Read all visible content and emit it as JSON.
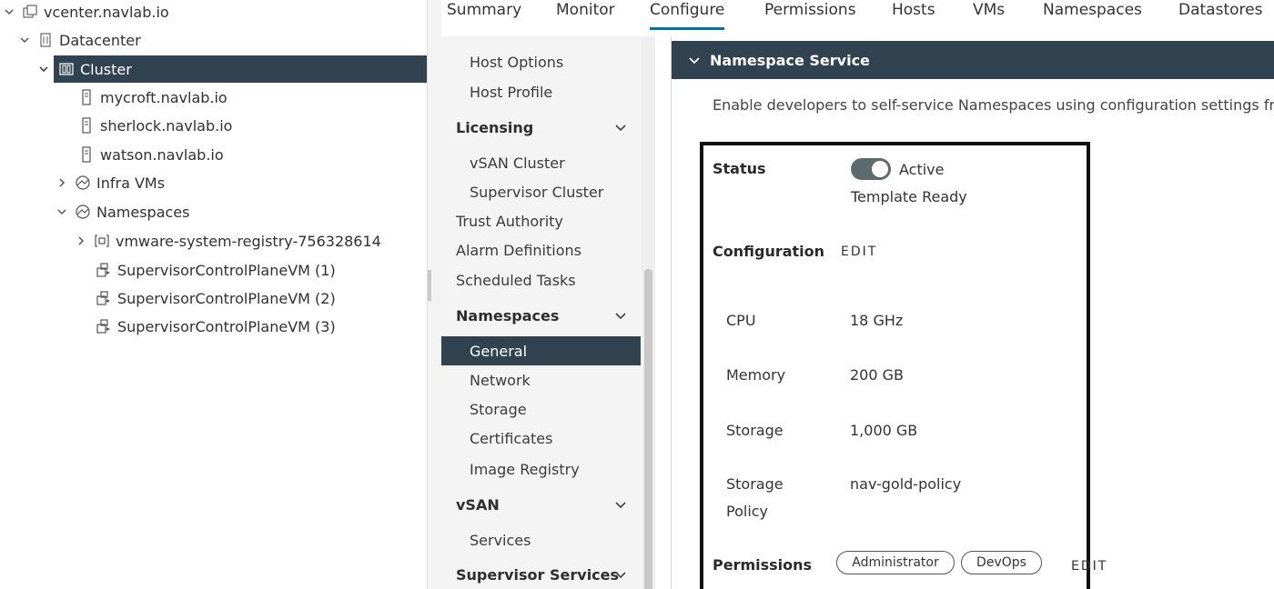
{
  "tree": {
    "items": [
      {
        "label": "vcenter.navlab.io",
        "icon": "vcenter-icon",
        "chev": "down"
      },
      {
        "label": "Datacenter",
        "icon": "datacenter-icon",
        "chev": "down"
      },
      {
        "label": "Cluster",
        "icon": "cluster-icon",
        "chev": "down",
        "selected": true
      },
      {
        "label": "mycroft.navlab.io",
        "icon": "host-icon"
      },
      {
        "label": "sherlock.navlab.io",
        "icon": "host-icon"
      },
      {
        "label": "watson.navlab.io",
        "icon": "host-icon"
      },
      {
        "label": "Infra VMs",
        "icon": "resource-pool-icon",
        "chev": "right"
      },
      {
        "label": "Namespaces",
        "icon": "resource-pool-icon",
        "chev": "down"
      },
      {
        "label": "vmware-system-registry-756328614",
        "icon": "namespace-icon",
        "chev": "right"
      },
      {
        "label": "SupervisorControlPlaneVM (1)",
        "icon": "vm-icon"
      },
      {
        "label": "SupervisorControlPlaneVM (2)",
        "icon": "vm-icon"
      },
      {
        "label": "SupervisorControlPlaneVM (3)",
        "icon": "vm-icon"
      }
    ]
  },
  "tabs": [
    {
      "label": "Summary"
    },
    {
      "label": "Monitor"
    },
    {
      "label": "Configure",
      "active": true
    },
    {
      "label": "Permissions"
    },
    {
      "label": "Hosts"
    },
    {
      "label": "VMs"
    },
    {
      "label": "Namespaces"
    },
    {
      "label": "Datastores"
    }
  ],
  "confnav": {
    "items": [
      {
        "label": "Host Options",
        "kind": "sub"
      },
      {
        "label": "Host Profile",
        "kind": "sub"
      },
      {
        "label": "Licensing",
        "kind": "hdr"
      },
      {
        "label": "vSAN Cluster",
        "kind": "sub"
      },
      {
        "label": "Supervisor Cluster",
        "kind": "sub"
      },
      {
        "label": "Trust Authority",
        "kind": "top"
      },
      {
        "label": "Alarm Definitions",
        "kind": "top"
      },
      {
        "label": "Scheduled Tasks",
        "kind": "top"
      },
      {
        "label": "Namespaces",
        "kind": "hdr"
      },
      {
        "label": "General",
        "kind": "sub",
        "active": true
      },
      {
        "label": "Network",
        "kind": "sub"
      },
      {
        "label": "Storage",
        "kind": "sub"
      },
      {
        "label": "Certificates",
        "kind": "sub"
      },
      {
        "label": "Image Registry",
        "kind": "sub"
      },
      {
        "label": "vSAN",
        "kind": "hdr"
      },
      {
        "label": "Services",
        "kind": "sub"
      },
      {
        "label": "Supervisor Services",
        "kind": "hdr"
      }
    ]
  },
  "main": {
    "section_title": "Namespace Service",
    "description": "Enable developers to self-service Namespaces using configuration settings fro",
    "status": {
      "label": "Status",
      "toggle_on": true,
      "value": "Active",
      "subvalue": "Template Ready"
    },
    "configuration": {
      "label": "Configuration",
      "edit_label": "EDIT",
      "rows": [
        {
          "label": "CPU",
          "value": "18 GHz"
        },
        {
          "label": "Memory",
          "value": "200 GB"
        },
        {
          "label": "Storage",
          "value": "1,000 GB"
        },
        {
          "label": "Storage Policy",
          "label_line1": "Storage",
          "label_line2": "Policy",
          "value": "nav-gold-policy"
        }
      ]
    },
    "permissions": {
      "label": "Permissions",
      "badges": [
        "Administrator",
        "DevOps"
      ],
      "edit_label": "EDIT"
    }
  },
  "colors": {
    "selected_bg": "#314351",
    "tab_active": "#0072a3",
    "nav_bg": "#f4f4f4"
  }
}
